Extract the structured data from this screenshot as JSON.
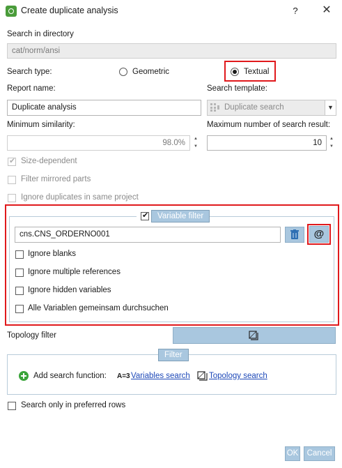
{
  "window": {
    "title": "Create duplicate analysis",
    "help_label": "?",
    "close_label": "✕"
  },
  "directory": {
    "label": "Search in directory",
    "value": "cat/norm/ansi"
  },
  "search_type": {
    "label": "Search type:",
    "options": [
      "Geometric",
      "Textual"
    ],
    "selected": "Textual"
  },
  "report_name": {
    "label": "Report name:",
    "value": "Duplicate analysis"
  },
  "search_template": {
    "label": "Search template:",
    "value": "Duplicate search",
    "icon": "template-grid-icon"
  },
  "min_similarity": {
    "label": "Minimum similarity:",
    "value": "98.0%"
  },
  "max_results": {
    "label": "Maximum number of search result:",
    "value": "10"
  },
  "options": {
    "size_dependent": {
      "label": "Size-dependent",
      "checked": true,
      "enabled": false
    },
    "filter_mirrored": {
      "label": "Filter mirrored parts",
      "checked": false,
      "enabled": false
    },
    "ignore_duplicates": {
      "label": "Ignore duplicates in same project",
      "checked": false,
      "enabled": false
    }
  },
  "variable_filter": {
    "legend": "Variable filter",
    "checked": true,
    "value": "cns.CNS_ORDERNO001",
    "at_button_label": "@",
    "options": [
      {
        "label": "Ignore blanks",
        "checked": false
      },
      {
        "label": "Ignore multiple references",
        "checked": false
      },
      {
        "label": "Ignore hidden variables",
        "checked": false
      },
      {
        "label": "Alle Variablen gemeinsam durchsuchen",
        "checked": false
      }
    ]
  },
  "topology": {
    "label": "Topology filter"
  },
  "filter_group": {
    "legend": "Filter",
    "add_label": "Add search function:",
    "variables_prefix": "A=3",
    "variables_link": "Variables search",
    "topology_link": "Topology search"
  },
  "preferred_rows": {
    "label": "Search only in preferred rows",
    "checked": false
  },
  "buttons": {
    "ok": "OK",
    "cancel": "Cancel"
  },
  "colors": {
    "highlight": "#e0191c",
    "accent_blue": "#a9c7df",
    "link": "#1e49b8",
    "add_icon_green": "#3aa43a"
  }
}
